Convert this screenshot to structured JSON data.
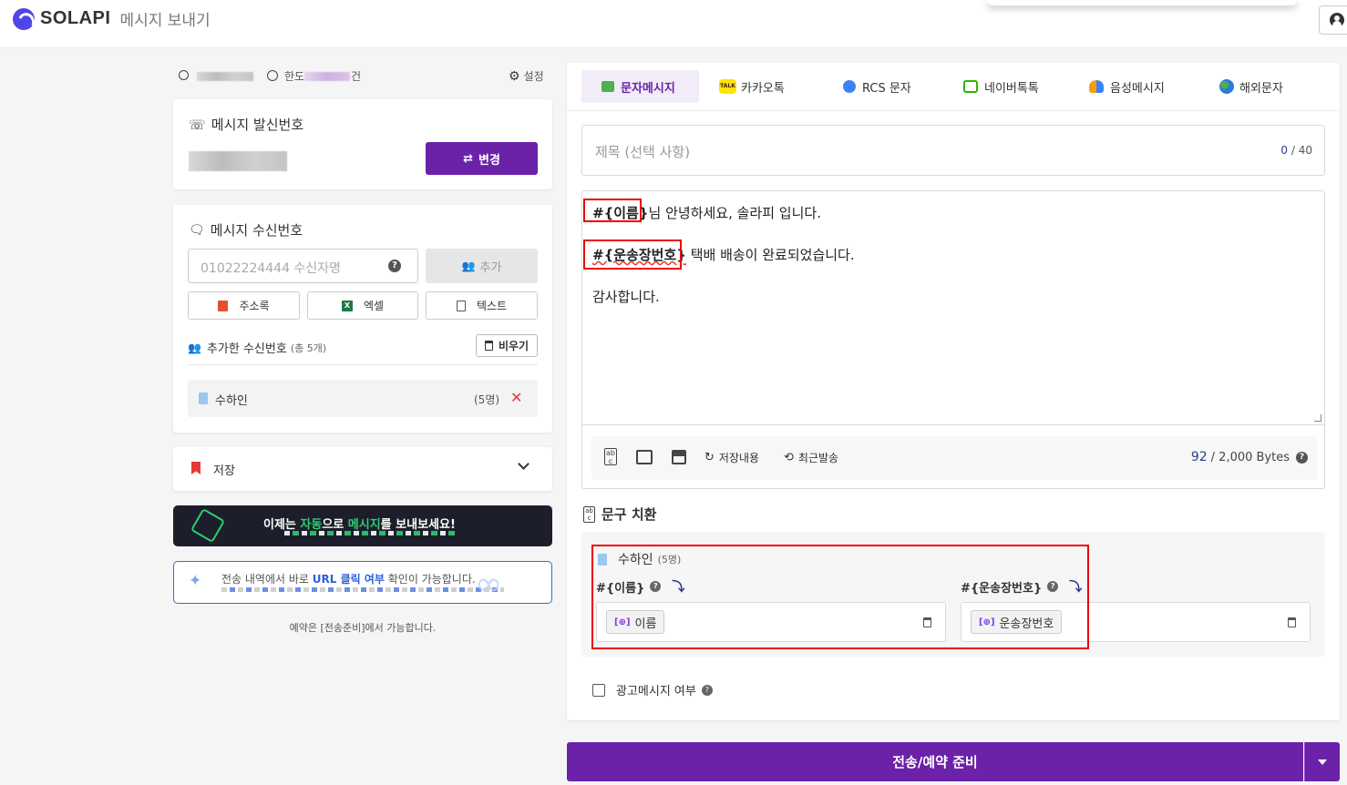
{
  "header": {
    "logo_text": "SOLAPI",
    "page_title": "메시지 보내기"
  },
  "stats": {
    "limit_label_prefix": "한도",
    "limit_label_suffix": "건",
    "settings_label": "설정"
  },
  "sender": {
    "title": "메시지 발신번호",
    "change_button": "변경"
  },
  "recipient": {
    "title": "메시지 수신번호",
    "input_placeholder": "01022224444 수신자명",
    "add_button": "추가",
    "address_book_button": "주소록",
    "excel_button": "엑셀",
    "text_button": "텍스트",
    "added_label": "추가한 수신번호",
    "added_count": "(총 5개)",
    "clear_button": "비우기",
    "group_name": "수하인",
    "group_count": "(5명)"
  },
  "storage": {
    "label": "저장"
  },
  "banners": {
    "auto_text_1": "이제는 ",
    "auto_text_2": "자동",
    "auto_text_3": "으로 ",
    "auto_text_4": "메시지",
    "auto_text_5": "를 보내보세요!",
    "url_text_1": "전송 내역에서 바로 ",
    "url_text_2": "URL 클릭 여부",
    "url_text_3": " 확인이 가능합니다."
  },
  "reservation_note": "예약은 [전송준비]에서 가능합니다.",
  "tabs": [
    {
      "label": "문자메시지",
      "icon": "message-icon",
      "active": true
    },
    {
      "label": "카카오톡",
      "icon": "kakao-icon",
      "active": false
    },
    {
      "label": "RCS 문자",
      "icon": "rcs-icon",
      "active": false
    },
    {
      "label": "네이버톡톡",
      "icon": "naver-icon",
      "active": false
    },
    {
      "label": "음성메시지",
      "icon": "voice-icon",
      "active": false
    },
    {
      "label": "해외문자",
      "icon": "globe-icon",
      "active": false
    }
  ],
  "message": {
    "subject_placeholder": "제목 (선택 사항)",
    "subject_count": "0",
    "subject_max": "/ 40",
    "line1_var": "#{이름}",
    "line1_text": "님 안녕하세요, 솔라피 입니다.",
    "line2_var": "#{운송장번호}",
    "line2_text": " 택배 배송이 완료되었습니다.",
    "line3_text": "감사합니다.",
    "saved_label": "저장내용",
    "recent_label": "최근발송",
    "bytes_used": "92",
    "bytes_max": "/ 2,000 Bytes"
  },
  "substitution": {
    "title": "문구 치환",
    "group_name": "수하인",
    "group_count": "(5명)",
    "var1_label": "#{이름}",
    "var1_value": "이름",
    "var2_label": "#{운송장번호}",
    "var2_value": "운송장번호"
  },
  "ad_checkbox_label": "광고메시지 여부",
  "send_button": "전송/예약 준비",
  "colors": {
    "brand_purple": "#6b21a8",
    "highlight_red": "#ee0000",
    "bytes_blue": "#2b3a8f"
  }
}
